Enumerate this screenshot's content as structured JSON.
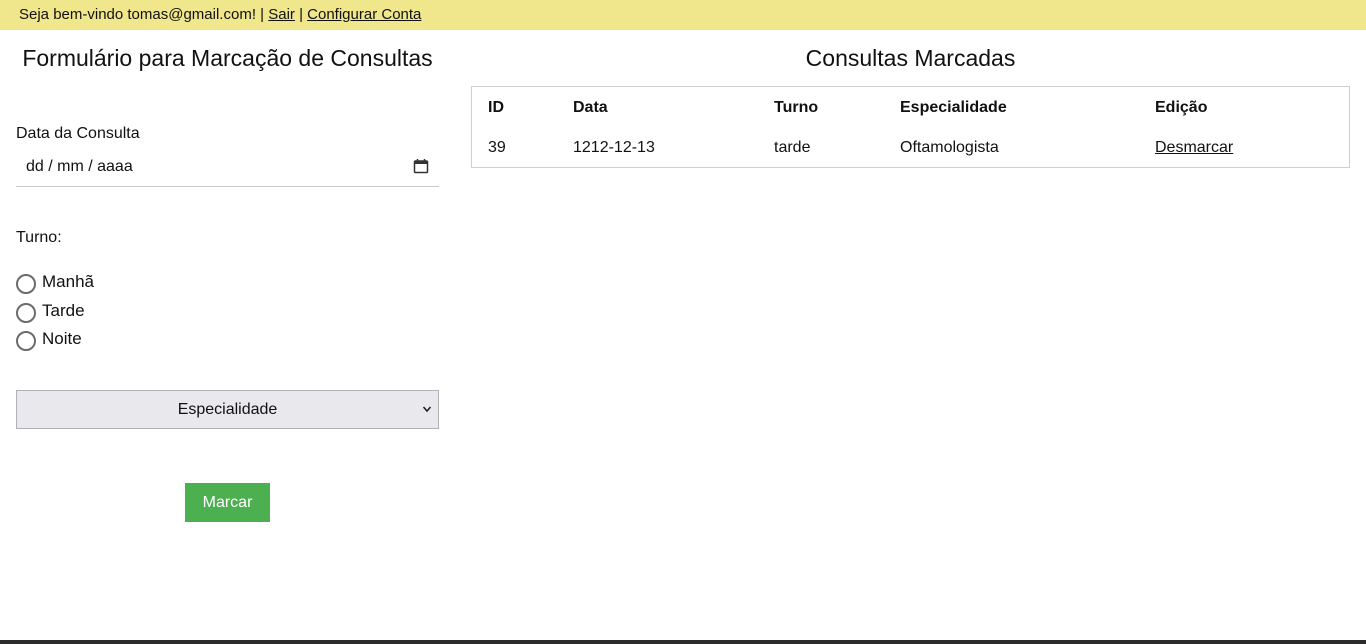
{
  "topbar": {
    "welcome": "Seja bem-vindo tomas@gmail.com! |",
    "logout": "Sair",
    "separator": "|",
    "account": "Configurar Conta",
    "bg_color": "#f0e68c"
  },
  "form": {
    "title": "Formulário para Marcação de Consultas",
    "date_label": "Data da Consulta",
    "date_placeholder": "dd / mm / aaaa",
    "calendar_icon": "calendar-icon",
    "turno_label": "Turno:",
    "radios": [
      {
        "label": "Manhã",
        "checked": false
      },
      {
        "label": "Tarde",
        "checked": false
      },
      {
        "label": "Noite",
        "checked": false
      }
    ],
    "select_value": "Especialidade",
    "submit_label": "Marcar",
    "submit_color": "#4caf50"
  },
  "appointments": {
    "title": "Consultas Marcadas",
    "columns": [
      "ID",
      "Data",
      "Turno",
      "Especialidade",
      "Edição"
    ],
    "rows": [
      {
        "id": "39",
        "date": "1212-12-13",
        "turno": "tarde",
        "especialidade": "Oftamologista",
        "action": "Desmarcar"
      }
    ]
  }
}
